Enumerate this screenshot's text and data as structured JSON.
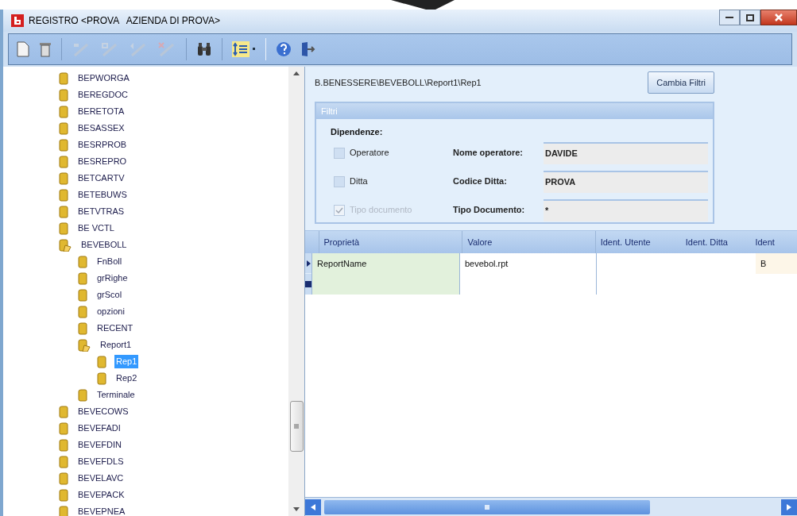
{
  "window": {
    "title": "REGISTRO <PROVA   AZIENDA DI PROVA>"
  },
  "tree": [
    {
      "label": "BEPWORGA",
      "expanded": false,
      "selected": false
    },
    {
      "label": "BEREGDOC",
      "expanded": false,
      "selected": false
    },
    {
      "label": "BERETOTA",
      "expanded": false,
      "selected": false
    },
    {
      "label": "BESASSEX",
      "expanded": false,
      "selected": false
    },
    {
      "label": "BESRPROB",
      "expanded": false,
      "selected": false
    },
    {
      "label": "BESREPRO",
      "expanded": false,
      "selected": false
    },
    {
      "label": "BETCARTV",
      "expanded": false,
      "selected": false
    },
    {
      "label": "BETEBUWS",
      "expanded": false,
      "selected": false
    },
    {
      "label": "BETVTRAS",
      "expanded": false,
      "selected": false
    },
    {
      "label": "BE VCTL",
      "expanded": false,
      "selected": false
    },
    {
      "label": "BEVEBOLL",
      "expanded": true,
      "selected": false,
      "children": [
        {
          "label": "FnBoll",
          "expanded": false,
          "selected": false
        },
        {
          "label": "grRighe",
          "expanded": false,
          "selected": false
        },
        {
          "label": "grScol",
          "expanded": false,
          "selected": false
        },
        {
          "label": "opzioni",
          "expanded": false,
          "selected": false
        },
        {
          "label": "RECENT",
          "expanded": false,
          "selected": false
        },
        {
          "label": "Report1",
          "expanded": true,
          "selected": false,
          "children": [
            {
              "label": "Rep1",
              "expanded": false,
              "selected": true
            },
            {
              "label": "Rep2",
              "expanded": false,
              "selected": false
            }
          ]
        },
        {
          "label": "Terminale",
          "expanded": false,
          "selected": false
        }
      ]
    },
    {
      "label": "BEVECOWS",
      "expanded": false,
      "selected": false
    },
    {
      "label": "BEVEFADI",
      "expanded": false,
      "selected": false
    },
    {
      "label": "BEVEFDIN",
      "expanded": false,
      "selected": false
    },
    {
      "label": "BEVEFDLS",
      "expanded": false,
      "selected": false
    },
    {
      "label": "BEVELAVC",
      "expanded": false,
      "selected": false
    },
    {
      "label": "BEVEPACK",
      "expanded": false,
      "selected": false
    },
    {
      "label": "BEVEPNEA",
      "expanded": false,
      "selected": false
    }
  ],
  "path": "B.BENESSERE\\BEVEBOLL\\Report1\\Rep1",
  "change_filters_button": "Cambia Filtri",
  "filters": {
    "title": "Filtri",
    "dependencies_label": "Dipendenze:",
    "checkboxes": [
      {
        "label": "Operatore",
        "checked": false,
        "disabled": false
      },
      {
        "label": "Ditta",
        "checked": false,
        "disabled": false
      },
      {
        "label": "Tipo documento",
        "checked": true,
        "disabled": true
      }
    ],
    "fields": [
      {
        "label": "Nome operatore:",
        "value": "DAVIDE"
      },
      {
        "label": "Codice Ditta:",
        "value": "PROVA"
      },
      {
        "label": "Tipo Documento:",
        "value": "*"
      }
    ]
  },
  "grid": {
    "columns": [
      "Proprietà",
      "Valore",
      "Ident. Utente",
      "Ident. Ditta",
      "Ident"
    ],
    "rows": [
      {
        "current": true,
        "cells": [
          "ReportName",
          "bevebol.rpt",
          "",
          "",
          "B"
        ]
      }
    ]
  }
}
